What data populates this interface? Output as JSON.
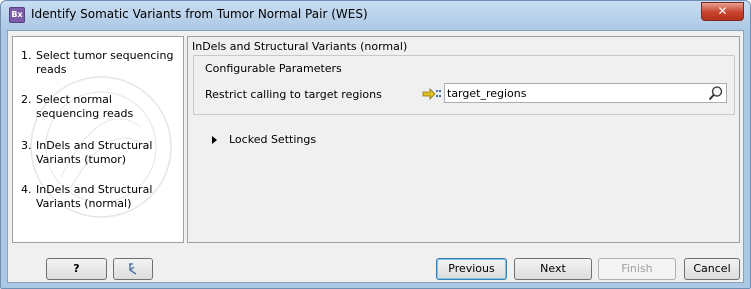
{
  "window": {
    "icon_text": "Bx",
    "title": "Identify Somatic Variants from Tumor Normal Pair (WES)",
    "close_symbol": "✕"
  },
  "steps": [
    {
      "num": "1.",
      "label": "Select tumor sequencing reads"
    },
    {
      "num": "2.",
      "label": "Select normal sequencing reads"
    },
    {
      "num": "3.",
      "label": "InDels and Structural Variants (tumor)"
    },
    {
      "num": "4.",
      "label": "InDels and Structural Variants (normal)"
    }
  ],
  "content": {
    "section_title": "InDels and Structural Variants (normal)",
    "configurable_title": "Configurable Parameters",
    "param_label": "Restrict calling to target regions",
    "param_value": "target_regions",
    "locked_settings": "Locked Settings"
  },
  "buttons": {
    "help": "?",
    "previous": "Previous",
    "next": "Next",
    "finish": "Finish",
    "cancel": "Cancel"
  },
  "icons": {
    "app": "bx-app-icon",
    "reset": "reset-arrow-icon",
    "browse": "browse-magnifier-icon",
    "input_type": "workflow-input-icon",
    "expand": "expand-triangle-icon"
  },
  "colors": {
    "title_bar": "#c9ddf1",
    "close_button": "#c7422a",
    "default_button_border": "#3c7fb1"
  }
}
